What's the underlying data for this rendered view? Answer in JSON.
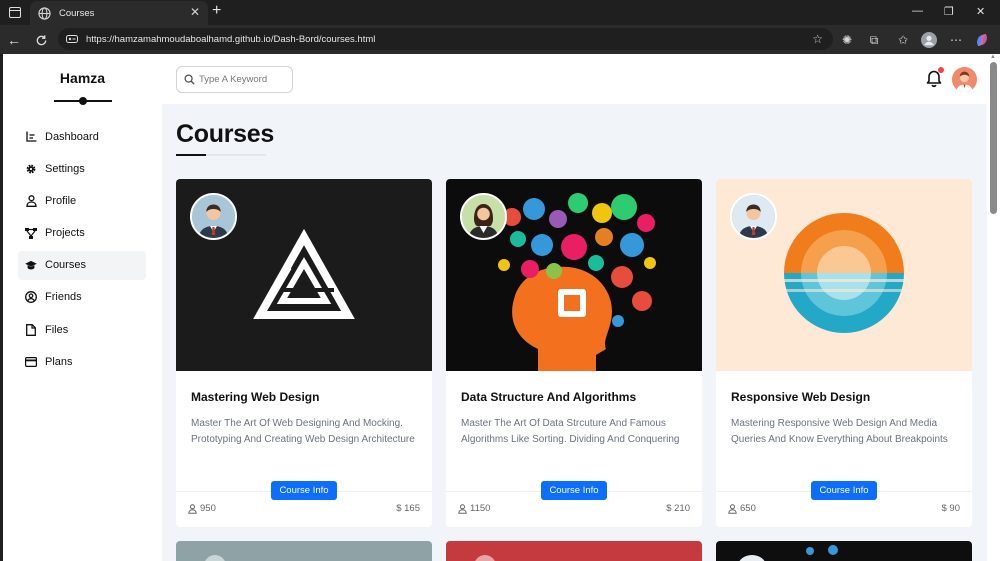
{
  "browser": {
    "tab_title": "Courses",
    "url": "https://hamzamahmoudaboalhamd.github.io/Dash-Bord/courses.html"
  },
  "sidebar": {
    "brand": "Hamza",
    "items": [
      {
        "label": "Dashboard",
        "icon": "chart-icon"
      },
      {
        "label": "Settings",
        "icon": "gear-icon"
      },
      {
        "label": "Profile",
        "icon": "user-icon"
      },
      {
        "label": "Projects",
        "icon": "diagram-icon"
      },
      {
        "label": "Courses",
        "icon": "graduation-cap-icon",
        "active": true
      },
      {
        "label": "Friends",
        "icon": "user-circle-icon"
      },
      {
        "label": "Files",
        "icon": "file-icon"
      },
      {
        "label": "Plans",
        "icon": "credit-card-icon"
      }
    ]
  },
  "header": {
    "search_placeholder": "Type A Keyword",
    "notification_color": "#ef4444"
  },
  "main": {
    "title": "Courses",
    "courses": [
      {
        "title": "Mastering Web Design",
        "description": "Master The Art Of Web Designing And Mocking. Prototyping And Creating Web Design Architecture",
        "button": "Course Info",
        "students": "950",
        "price": "$ 165"
      },
      {
        "title": "Data Structure And Algorithms",
        "description": "Master The Art Of Data Strcuture And Famous Algorithms Like Sorting. Dividing And Conquering",
        "button": "Course Info",
        "students": "1150",
        "price": "$ 210"
      },
      {
        "title": "Responsive Web Design",
        "description": "Mastering Responsive Web Design And Media Queries And Know Everything About Breakpoints",
        "button": "Course Info",
        "students": "650",
        "price": "$ 90"
      }
    ]
  },
  "colors": {
    "accent": "#0d6efd",
    "page_bg": "#f1f5f9"
  }
}
